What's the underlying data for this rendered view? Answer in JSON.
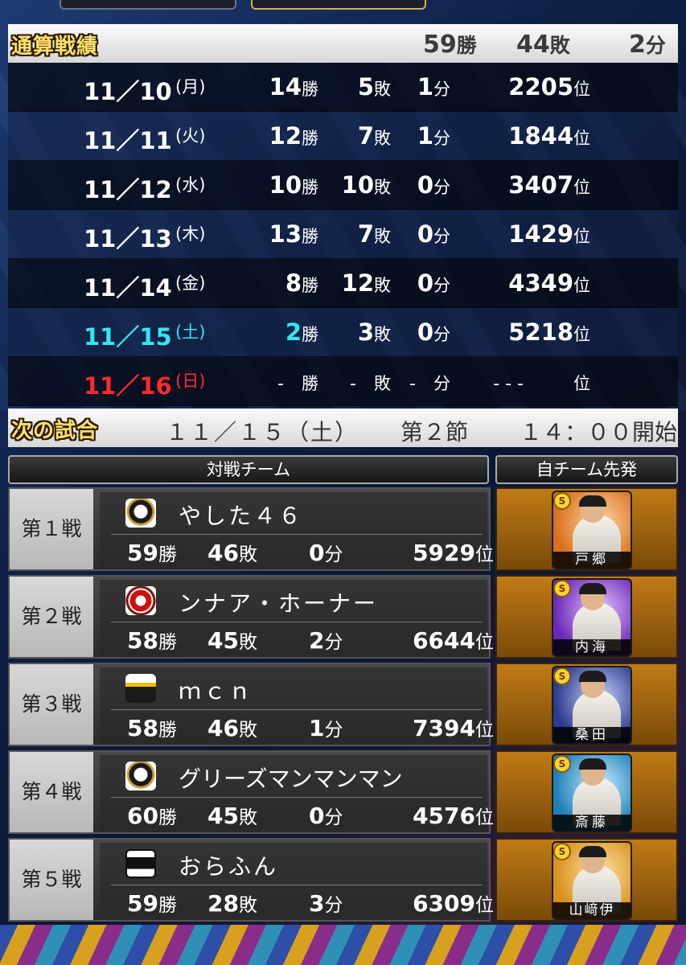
{
  "summary": {
    "title": "通算戦績",
    "wins": "59",
    "wins_unit": "勝",
    "losses": "44",
    "losses_unit": "敗",
    "draws": "2",
    "draws_unit": "分"
  },
  "units": {
    "win": "勝",
    "loss": "敗",
    "draw": "分",
    "rank": "位"
  },
  "daily": [
    {
      "date": "11／10",
      "dow": "(月)",
      "wins": "14",
      "losses": "5",
      "draws": "1",
      "rank": "2205"
    },
    {
      "date": "11／11",
      "dow": "(火)",
      "wins": "12",
      "losses": "7",
      "draws": "1",
      "rank": "1844"
    },
    {
      "date": "11／12",
      "dow": "(水)",
      "wins": "10",
      "losses": "10",
      "draws": "0",
      "rank": "3407"
    },
    {
      "date": "11／13",
      "dow": "(木)",
      "wins": "13",
      "losses": "7",
      "draws": "0",
      "rank": "1429"
    },
    {
      "date": "11／14",
      "dow": "(金)",
      "wins": "8",
      "losses": "12",
      "draws": "0",
      "rank": "4349"
    },
    {
      "date": "11／15",
      "dow": "(土)",
      "wins": "2",
      "losses": "3",
      "draws": "0",
      "rank": "5218"
    },
    {
      "date": "11／16",
      "dow": "(日)",
      "wins": "-",
      "losses": "-",
      "draws": "-",
      "rank": "- - -"
    }
  ],
  "next": {
    "title": "次の試合",
    "date": "１１／１５（土）",
    "round": "第２節",
    "start": "１４：００開始"
  },
  "columns": {
    "opponent": "対戦チーム",
    "starter": "自チーム先発"
  },
  "matches": [
    {
      "label": "第１戦",
      "team": "やした４６",
      "logo": "buffaloes-logo",
      "wins": "59",
      "losses": "46",
      "draws": "0",
      "rank": "5929",
      "pitcher": "戸郷"
    },
    {
      "label": "第２戦",
      "team": "ンナア・ホーナー",
      "logo": "lions-logo",
      "wins": "58",
      "losses": "45",
      "draws": "2",
      "rank": "6644",
      "pitcher": "内海"
    },
    {
      "label": "第３戦",
      "team": "ｍｃｎ",
      "logo": "hawks-logo",
      "wins": "58",
      "losses": "46",
      "draws": "1",
      "rank": "7394",
      "pitcher": "桑田"
    },
    {
      "label": "第４戦",
      "team": "グリーズマンマンマン",
      "logo": "buffaloes-logo",
      "wins": "60",
      "losses": "45",
      "draws": "0",
      "rank": "4576",
      "pitcher": "斎藤"
    },
    {
      "label": "第５戦",
      "team": "おらふん",
      "logo": "buffaloes-classic-logo",
      "wins": "59",
      "losses": "28",
      "draws": "3",
      "rank": "6309",
      "pitcher": "山﨑伊"
    }
  ],
  "badge": "S"
}
